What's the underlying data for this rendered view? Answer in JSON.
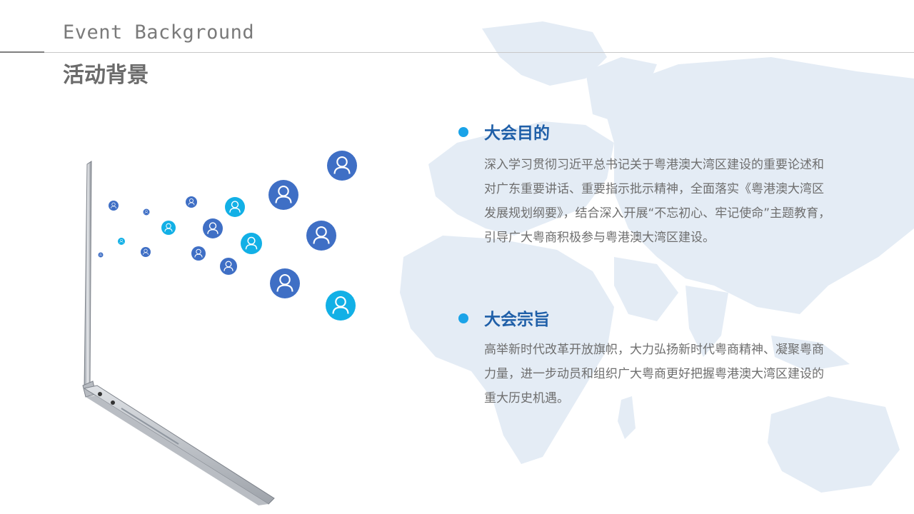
{
  "header": {
    "title_en": "Event Background",
    "title_cn": "活动背景"
  },
  "sections": [
    {
      "title": "大会目的",
      "body": "深入学习贯彻习近平总书记关于粤港澳大湾区建设的重要论述和对广东重要讲话、重要指示批示精神，全面落实《粤港澳大湾区发展规划纲要》，结合深入开展“不忘初心、牢记使命”主题教育，引导广大粤商积极参与粤港澳大湾区建设。"
    },
    {
      "title": "大会宗旨",
      "body": "高举新时代改革开放旗帜，大力弘扬新时代粤商精神、凝聚粤商力量，进一步动员和组织广大粤商更好把握粤港澳大湾区建设的重大历史机遇。"
    }
  ],
  "colors": {
    "accent_blue": "#1aa3e8",
    "title_blue": "#1f5fa8",
    "avatar_dark": "#3f6fc5",
    "avatar_light": "#12b0e6",
    "map": "#e4ecf5"
  },
  "icons": {
    "bullet": "circle-bullet-icon",
    "avatar": "user-avatar-icon",
    "laptop": "laptop-image",
    "map": "world-map-image"
  }
}
